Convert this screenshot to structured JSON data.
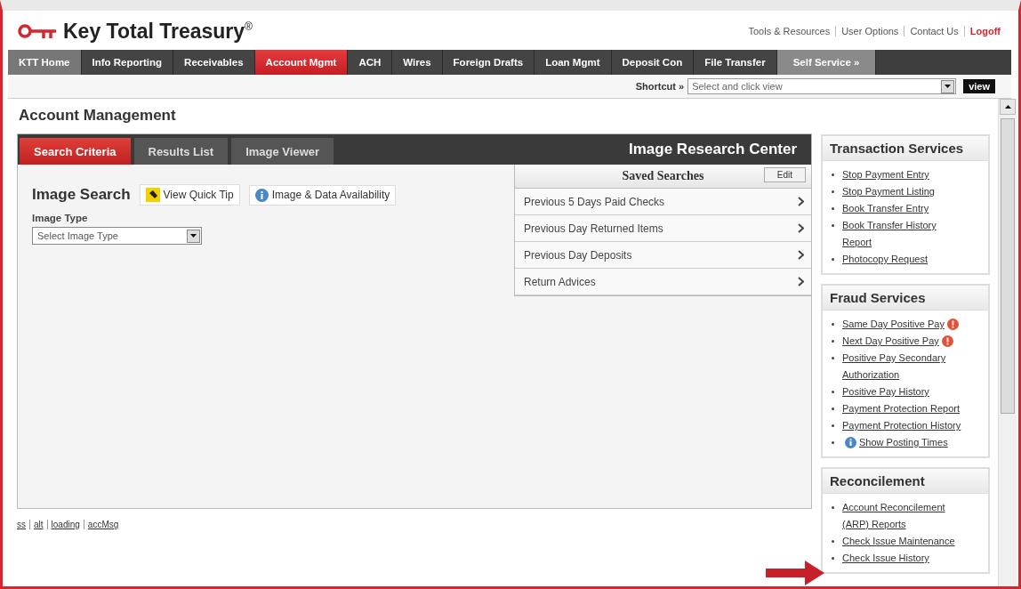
{
  "brand": {
    "name": "Key Total Treasury$^{®}$"
  },
  "top_links": [
    {
      "label": "Tools & Resources",
      "kind": "plain"
    },
    {
      "label": "User Options",
      "kind": "plain"
    },
    {
      "label": "Contact Us",
      "kind": "plain"
    },
    {
      "label": "Logoff",
      "kind": "accent"
    }
  ],
  "nav": [
    {
      "label": "KTT Home",
      "kind": "home",
      "selected": false
    },
    {
      "label": "Info Reporting",
      "kind": "tab",
      "selected": false
    },
    {
      "label": "Receivables",
      "kind": "tab",
      "selected": false
    },
    {
      "label": "Account Mgmt",
      "kind": "tab",
      "selected": true
    },
    {
      "label": "ACH",
      "kind": "tab",
      "selected": false
    },
    {
      "label": "Wires",
      "kind": "tab",
      "selected": false
    },
    {
      "label": "Foreign Drafts",
      "kind": "tab",
      "selected": false
    },
    {
      "label": "Loan Mgmt",
      "kind": "tab",
      "selected": false
    },
    {
      "label": "Deposit Con",
      "kind": "tab",
      "selected": false
    },
    {
      "label": "File Transfer",
      "kind": "tab",
      "selected": false
    },
    {
      "label": "Self Service »",
      "kind": "more",
      "selected": false
    }
  ],
  "shortcut": {
    "label": "Shortcut »",
    "value": "Select and click view",
    "button": "view"
  },
  "page_title": "Account Management",
  "panel": {
    "title": "Image Research Center",
    "tabs": [
      {
        "label": "Search Criteria",
        "selected": true
      },
      {
        "label": "Results List",
        "selected": false
      },
      {
        "label": "Image Viewer",
        "selected": false
      }
    ],
    "heading": "Image Search",
    "quick_tip": "View Quick Tip",
    "availability": "Image & Data Availability",
    "image_type": {
      "label": "Image Type",
      "value": "Select Image Type"
    },
    "saved_searches": {
      "title": "Saved Searches",
      "edit": "Edit",
      "items": [
        "Previous 5 Days Paid Checks",
        "Previous Day Returned Items",
        "Previous Day Deposits",
        "Return Advices"
      ]
    }
  },
  "footer_links": [
    "ss",
    "alt",
    "loading",
    "accMsg"
  ],
  "sidebar": [
    {
      "title": "Transaction Services",
      "items": [
        {
          "label": "Stop Payment Entry",
          "kind": "plain"
        },
        {
          "label": "Stop Payment Listing",
          "kind": "plain"
        },
        {
          "label": "Book Transfer Entry",
          "kind": "plain"
        },
        {
          "label": "Book Transfer History Report",
          "kind": "plain"
        },
        {
          "label": "Photocopy Request",
          "kind": "plain"
        }
      ]
    },
    {
      "title": "Fraud Services",
      "items": [
        {
          "label": "Same Day Positive Pay",
          "kind": "alert"
        },
        {
          "label": "Next Day Positive Pay",
          "kind": "alert"
        },
        {
          "label": "Positive Pay Secondary Authorization",
          "kind": "plain"
        },
        {
          "label": "Positive Pay History",
          "kind": "plain"
        },
        {
          "label": "Payment Protection Report",
          "kind": "plain"
        },
        {
          "label": "Payment Protection History",
          "kind": "plain"
        },
        {
          "label": "Show Posting Times",
          "kind": "info"
        }
      ]
    },
    {
      "title": "Reconcilement",
      "items": [
        {
          "label": "Account Reconcilement (ARP) Reports",
          "kind": "plain"
        },
        {
          "label": "Check Issue Maintenance",
          "kind": "plain"
        },
        {
          "label": "Check Issue History",
          "kind": "plain"
        }
      ]
    }
  ]
}
